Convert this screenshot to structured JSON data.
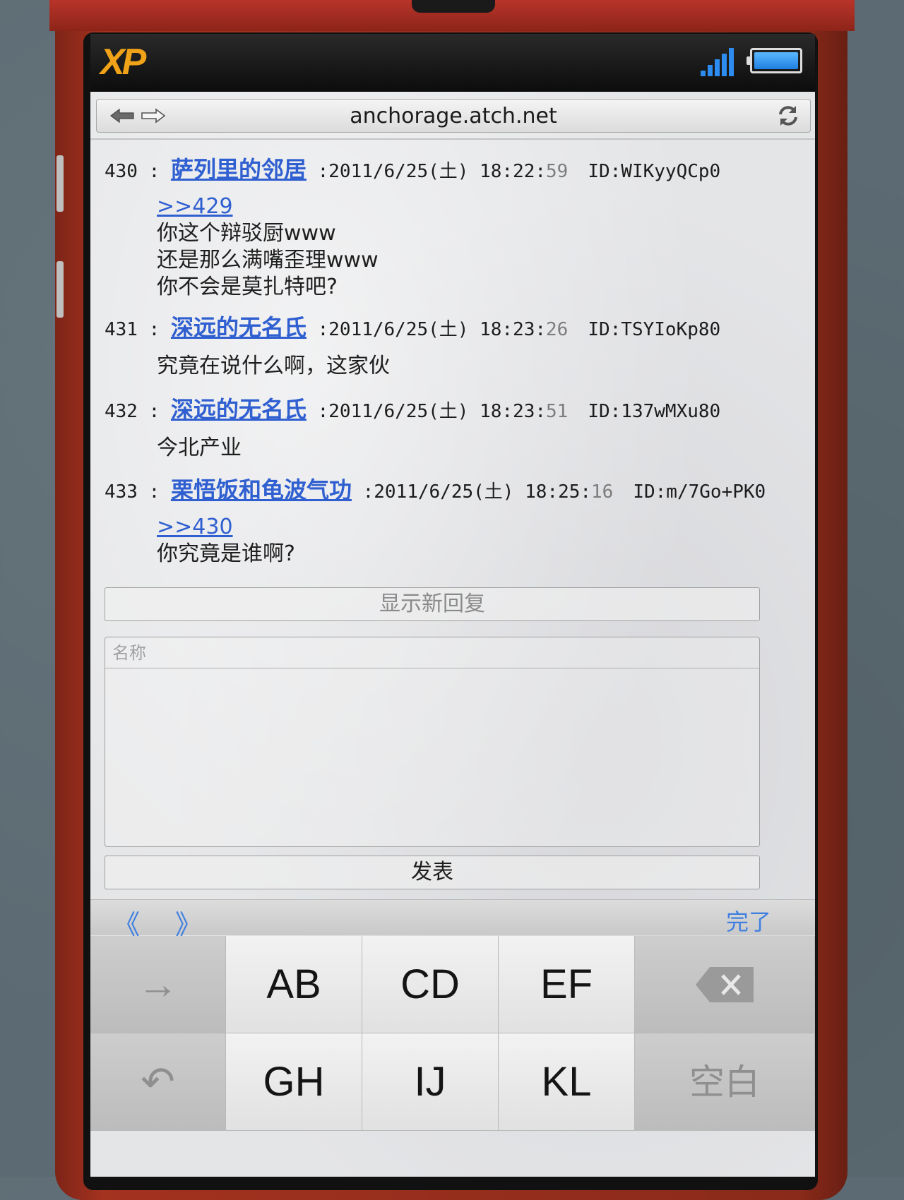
{
  "status_bar": {
    "logo": "XP"
  },
  "browser": {
    "url": "anchorage.atch.net"
  },
  "posts": [
    {
      "number": "430",
      "name": "萨列里的邻居",
      "date": "2011/6/25(土) 18:22:",
      "seconds": "59",
      "id": "ID:WIKyyQCp0",
      "reply_link": ">>429",
      "lines": [
        "你这个辩驳厨www",
        "还是那么满嘴歪理www",
        "你不会是莫扎特吧?"
      ]
    },
    {
      "number": "431",
      "name": "深远的无名氏",
      "date": "2011/6/25(土) 18:23:",
      "seconds": "26",
      "id": "ID:TSYIoKp80",
      "lines": [
        "究竟在说什么啊，这家伙"
      ]
    },
    {
      "number": "432",
      "name": "深远的无名氏",
      "date": "2011/6/25(土) 18:23:",
      "seconds": "51",
      "id": "ID:137wMXu80",
      "lines": [
        "今北产业"
      ]
    },
    {
      "number": "433",
      "name": "栗悟饭和龟波气功",
      "date": "2011/6/25(土) 18:25:",
      "seconds": "16",
      "id": "ID:m/7Go+PK0",
      "reply_link": ">>430",
      "lines": [
        "你究竟是谁啊?"
      ]
    }
  ],
  "show_new_label": "显示新回复",
  "form": {
    "name_placeholder": "名称",
    "submit_label": "发表"
  },
  "keyboard_toolbar": {
    "prev": "《",
    "next": "》",
    "done": "完了"
  },
  "keyboard": {
    "row1": [
      "→",
      "AB",
      "CD",
      "EF",
      "⌫"
    ],
    "row2": [
      "↶",
      "GH",
      "IJ",
      "KL",
      "空白"
    ]
  }
}
